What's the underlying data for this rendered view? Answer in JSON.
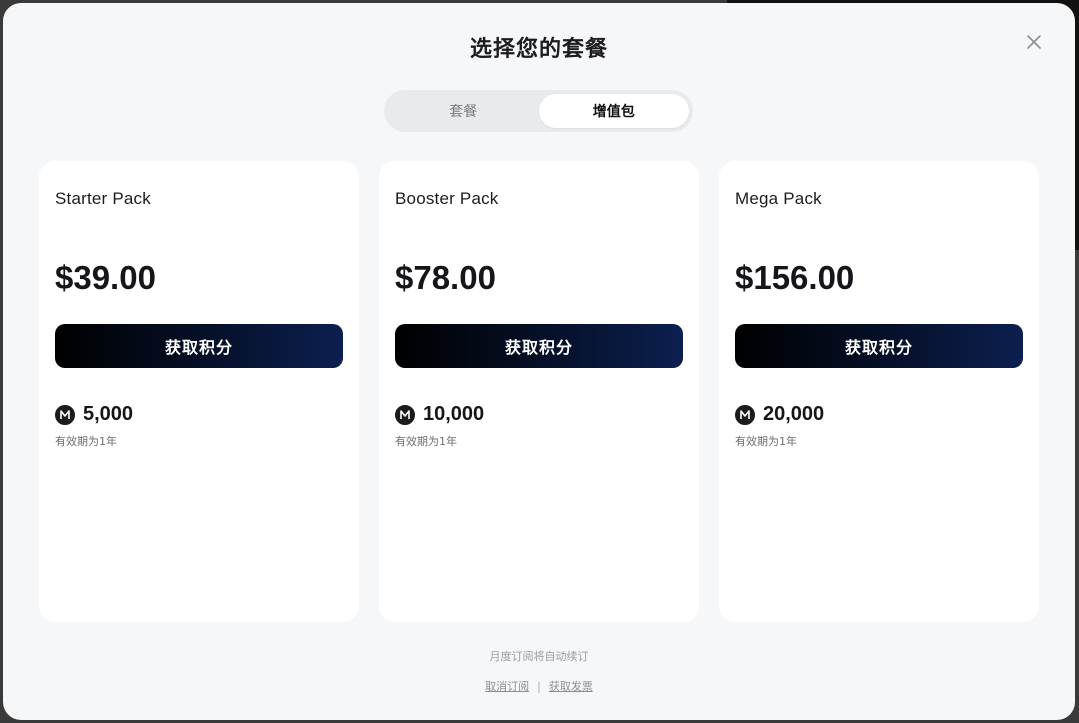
{
  "modal": {
    "title": "选择您的套餐"
  },
  "tabs": [
    {
      "label": "套餐",
      "active": false
    },
    {
      "label": "增值包",
      "active": true
    }
  ],
  "packs": [
    {
      "name": "Starter Pack",
      "price": "$39.00",
      "button_label": "获取积分",
      "credits": "5,000",
      "validity": "有效期为1年"
    },
    {
      "name": "Booster Pack",
      "price": "$78.00",
      "button_label": "获取积分",
      "credits": "10,000",
      "validity": "有效期为1年"
    },
    {
      "name": "Mega Pack",
      "price": "$156.00",
      "button_label": "获取积分",
      "credits": "20,000",
      "validity": "有效期为1年"
    }
  ],
  "footer": {
    "renew_note": "月度订阅将自动续订",
    "cancel_link": "取消订阅",
    "separator": "|",
    "invoice_link": "获取发票"
  },
  "colors": {
    "modal_bg": "#f6f7f9",
    "card_bg": "#ffffff",
    "button_gradient_start": "#000000",
    "button_gradient_end": "#0c1f4f"
  },
  "icons": {
    "close": "close-icon",
    "coin": "m-coin-icon"
  }
}
